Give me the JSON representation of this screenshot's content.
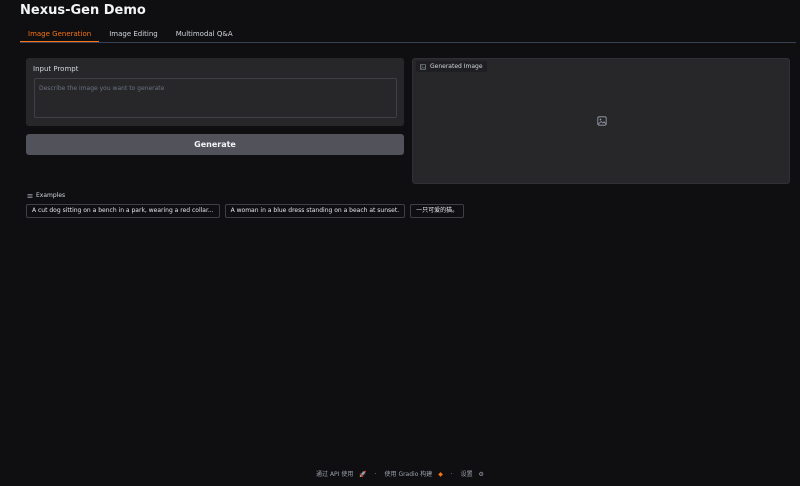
{
  "app": {
    "title": "Nexus-Gen Demo"
  },
  "tabs": [
    {
      "label": "Image Generation",
      "active": true
    },
    {
      "label": "Image Editing",
      "active": false
    },
    {
      "label": "Multimodal Q&A",
      "active": false
    }
  ],
  "prompt": {
    "label": "Input Prompt",
    "placeholder": "Describe the image you want to generate",
    "value": ""
  },
  "generate_button": {
    "label": "Generate"
  },
  "output": {
    "label": "Generated Image",
    "icon": "image-icon"
  },
  "examples": {
    "label": "Examples",
    "items": [
      "A cut dog sitting on a bench in a park, wearing a red collar...",
      "A woman in a blue dress standing on a beach at sunset.",
      "一只可爱的猫。"
    ]
  },
  "footer": {
    "api": "通过 API 使用",
    "sep": "·",
    "built": "使用 Gradio 构建",
    "settings": "设置"
  },
  "colors": {
    "accent": "#f97316",
    "background": "#0f0f11",
    "panel": "#27272a"
  }
}
